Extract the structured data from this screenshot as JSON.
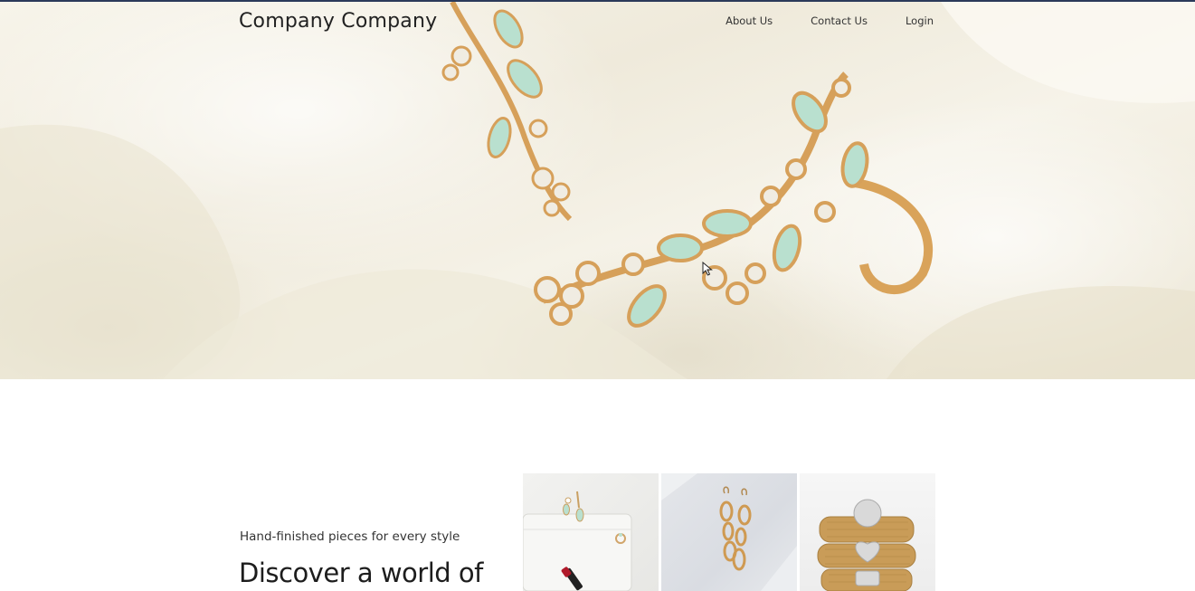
{
  "header": {
    "brand": "Company Company",
    "nav": [
      {
        "label": "About Us"
      },
      {
        "label": "Contact Us"
      },
      {
        "label": "Login"
      }
    ]
  },
  "hero": {
    "image": "earrings-on-cream-fabric"
  },
  "intro": {
    "tagline": "Hand-finished pieces for every style",
    "headline": "Discover a world of"
  },
  "gallery": {
    "tiles": [
      {
        "image": "pouch-with-earrings-and-lipstick"
      },
      {
        "image": "gold-loop-earrings"
      },
      {
        "image": "stacked-gold-rings"
      }
    ]
  },
  "colors": {
    "topbar": "#2b3a5a",
    "gold": "#d9a35a",
    "mint": "#b9e0cf"
  }
}
